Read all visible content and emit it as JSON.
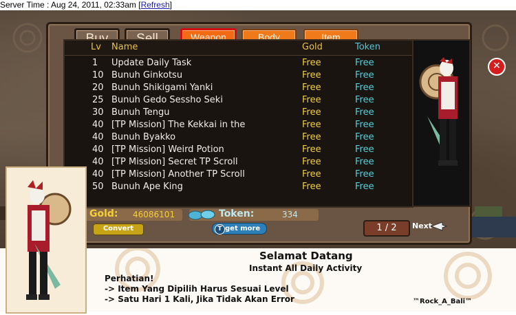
{
  "server_bar": {
    "label": "Server Time : Aug 24, 2011, 02:33am",
    "open_bracket": "[",
    "refresh": "Refresh",
    "close_bracket": "]"
  },
  "shop": {
    "buy": "Buy",
    "sell": "Sell"
  },
  "tabs": [
    {
      "label": "Weapon"
    },
    {
      "label": "Body"
    },
    {
      "label": "Item"
    }
  ],
  "columns": {
    "lv": "Lv",
    "name": "Name",
    "gold": "Gold",
    "token": "Token"
  },
  "rows": [
    {
      "lv": "1",
      "name": "Update Daily Task",
      "gold": "Free",
      "token": "Free"
    },
    {
      "lv": "10",
      "name": "Bunuh Ginkotsu",
      "gold": "Free",
      "token": "Free"
    },
    {
      "lv": "20",
      "name": "Bunuh Shikigami Yanki",
      "gold": "Free",
      "token": "Free"
    },
    {
      "lv": "25",
      "name": "Bunuh Gedo Sessho Seki",
      "gold": "Free",
      "token": "Free"
    },
    {
      "lv": "30",
      "name": "Bunuh Tengu",
      "gold": "Free",
      "token": "Free"
    },
    {
      "lv": "40",
      "name": "[TP Mission] The Kekkai in the",
      "gold": "Free",
      "token": "Free"
    },
    {
      "lv": "40",
      "name": "Bunuh Byakko",
      "gold": "Free",
      "token": "Free"
    },
    {
      "lv": "40",
      "name": "[TP Mission] Weird Potion",
      "gold": "Free",
      "token": "Free"
    },
    {
      "lv": "40",
      "name": "[TP Mission] Secret TP Scroll",
      "gold": "Free",
      "token": "Free"
    },
    {
      "lv": "40",
      "name": "[TP Mission] Another TP Scroll",
      "gold": "Free",
      "token": "Free"
    },
    {
      "lv": "50",
      "name": "Bunuh Ape King",
      "gold": "Free",
      "token": "Free"
    }
  ],
  "currency": {
    "gold_label": "Gold:",
    "gold_value": "46086101",
    "token_label": "Token:",
    "token_value": "334",
    "convert": "Convert",
    "get_more": "get more",
    "get_more_icon": "T"
  },
  "pagination": {
    "indicator": "1 / 2",
    "next": "Next"
  },
  "close": {
    "glyph": "✕"
  },
  "footer": {
    "title": "Selamat Datang",
    "subtitle": "Instant All Daily Activity",
    "warning": "Perhatian!",
    "line1": "-> Item Yang Dipilih Harus Sesuai Level",
    "line2": "-> Satu Hari 1 Kali, Jika Tidak Akan Error",
    "signature": "™Rock_A_Bali™"
  },
  "colors": {
    "tab": "#f07a1a",
    "active_tab_border": "#d01010",
    "gold_text": "#f0d040",
    "token_text": "#55d0dc"
  }
}
